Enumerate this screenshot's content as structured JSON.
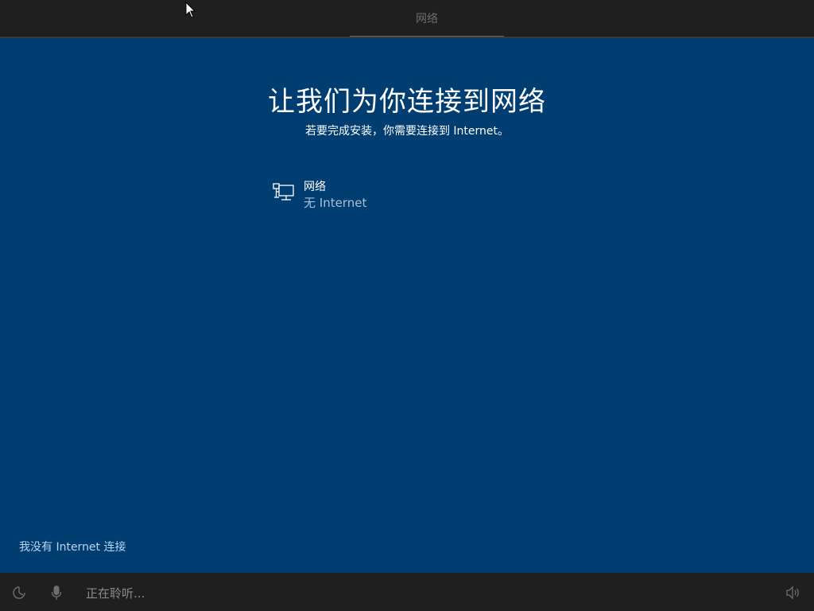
{
  "header": {
    "step_label": "网络"
  },
  "main": {
    "title": "让我们为你连接到网络",
    "subtitle": "若要完成安装，你需要连接到 Internet。",
    "networks": [
      {
        "name": "网络",
        "status": "无 Internet",
        "icon": "wired-network-icon"
      }
    ],
    "no_internet_link": "我没有 Internet 连接"
  },
  "bottombar": {
    "listening_text": "正在聆听...",
    "icons": [
      "ease-of-access-icon",
      "microphone-icon",
      "volume-icon"
    ]
  },
  "colors": {
    "background": "#003e72",
    "topbar": "#1f1f1f",
    "bottombar": "#1f1f1f",
    "link": "#b9d4f2"
  }
}
